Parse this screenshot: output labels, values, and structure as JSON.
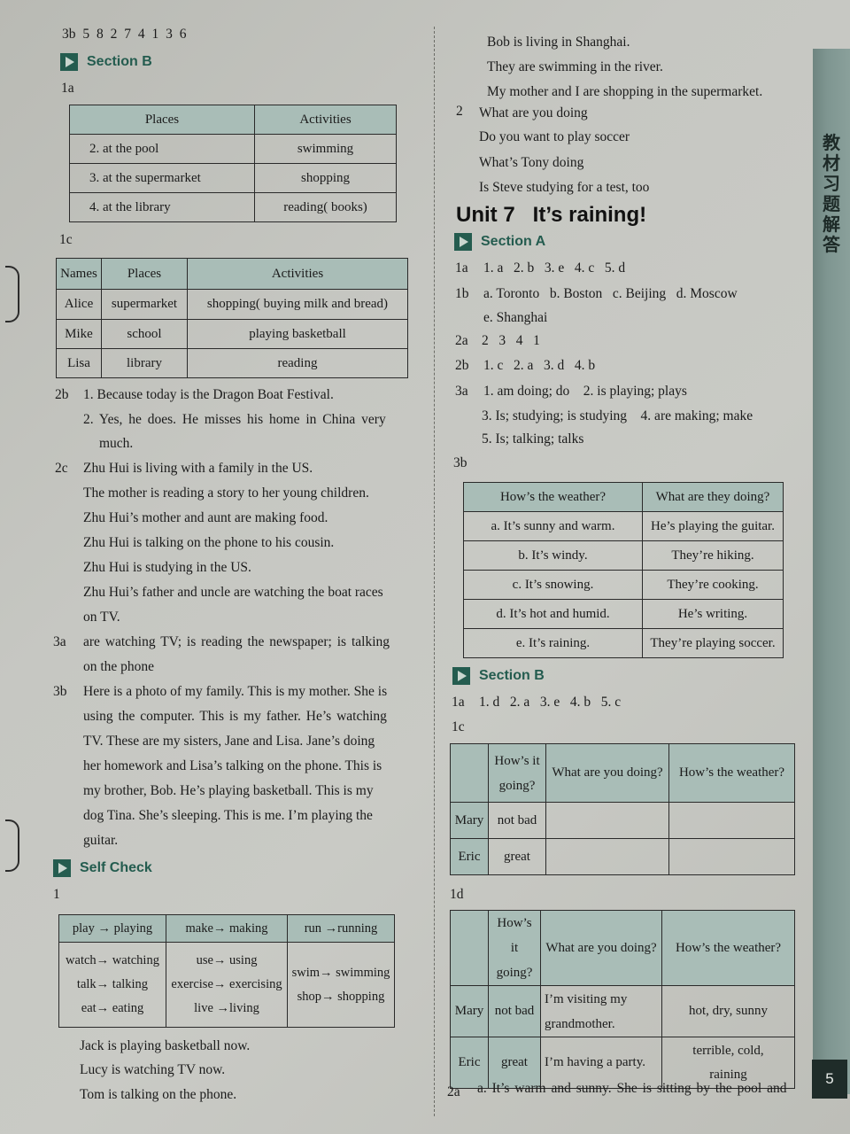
{
  "left": {
    "line_3b_top": "3b  5  8  2  7  4  1  3  6",
    "section_b": {
      "title": "Section B",
      "label_1a": "1a",
      "table_1a": {
        "headers": [
          "Places",
          "Activities"
        ],
        "rows": [
          [
            "2. at the pool",
            "swimming"
          ],
          [
            "3. at the supermarket",
            "shopping"
          ],
          [
            "4. at the library",
            "reading( books)"
          ]
        ]
      },
      "label_1c": "1c",
      "table_1c": {
        "headers": [
          "Names",
          "Places",
          "Activities"
        ],
        "rows": [
          [
            "Alice",
            "supermarket",
            "shopping( buying milk and bread)"
          ],
          [
            "Mike",
            "school",
            "playing basketball"
          ],
          [
            "Lisa",
            "library",
            "reading"
          ]
        ]
      },
      "label_2b": "2b",
      "answers_2b": [
        "1. Because today is the Dragon Boat Festival.",
        "2. Yes, he does. He misses his home in China very",
        "much."
      ],
      "label_2c": "2c",
      "answers_2c": [
        "Zhu Hui is living with a family in the US.",
        "The mother is reading a story to her young children.",
        "Zhu Hui’s mother and aunt are making food.",
        "Zhu Hui is talking on the phone to his cousin.",
        "Zhu Hui is studying in the US.",
        "Zhu Hui’s father and uncle are watching the boat races",
        "on TV."
      ],
      "label_3a": "3a",
      "answers_3a": [
        "are watching TV; is reading the newspaper; is talking",
        "on the phone"
      ],
      "label_3b": "3b",
      "answers_3b": [
        "Here is a photo of my family. This is my mother. She is",
        "using the computer. This is my father. He’s watching",
        "TV. These are my sisters, Jane and Lisa. Jane’s doing",
        "her homework and Lisa’s talking on the phone. This is",
        "my brother, Bob. He’s playing basketball. This is my",
        "dog Tina. She’s sleeping. This is me. I’m playing the",
        "guitar."
      ]
    },
    "self_check": {
      "title": "Self Check",
      "label_1": "1",
      "table": {
        "header_row": [
          "play → playing",
          "make→ making",
          "run →running"
        ],
        "body": [
          [
            "watch→ watching",
            "talk→ talking",
            "eat→ eating"
          ],
          [
            "use→ using",
            "exercise→ exercising",
            "live →living"
          ],
          [
            "swim→ swimming",
            "shop→ shopping"
          ]
        ]
      },
      "sentences": [
        "Jack is playing basketball now.",
        "Lucy is watching TV now.",
        "Tom is talking on the phone."
      ]
    }
  },
  "right": {
    "top_sentences": [
      "Bob is living in Shanghai.",
      "They are swimming in the river.",
      "My mother and I are shopping in the supermarket."
    ],
    "label_2": "2",
    "answers_2": [
      "What are you doing",
      "Do you want to play soccer",
      "What’s Tony doing",
      "Is Steve studying for a test, too"
    ],
    "unit": {
      "number": "Unit 7",
      "title": "It’s raining!"
    },
    "section_a": {
      "title": "Section A",
      "rows": [
        {
          "label": "1a",
          "text": "1. a   2. b   3. e   4. c   5. d"
        },
        {
          "label": "1b",
          "text": "a. Toronto   b. Boston   c. Beijing   d. Moscow"
        },
        {
          "label": "",
          "text": "e. Shanghai"
        },
        {
          "label": "2a",
          "text": "2   3   4   1"
        },
        {
          "label": "2b",
          "text": "1. c   2. a   3. d   4. b"
        },
        {
          "label": "3a",
          "text": "1. am doing; do    2. is playing; plays"
        },
        {
          "label": "",
          "text": "3. Is; studying; is studying    4. are making; make"
        },
        {
          "label": "",
          "text": "5. Is; talking; talks"
        }
      ],
      "label_3b": "3b",
      "table_3b": {
        "headers": [
          "How’s the weather?",
          "What are they doing?"
        ],
        "rows": [
          [
            "a. It’s sunny and warm.",
            "He’s playing the guitar."
          ],
          [
            "b. It’s windy.",
            "They’re hiking."
          ],
          [
            "c. It’s snowing.",
            "They’re cooking."
          ],
          [
            "d. It’s hot and humid.",
            "He’s writing."
          ],
          [
            "e. It’s raining.",
            "They’re playing soccer."
          ]
        ]
      }
    },
    "section_b": {
      "title": "Section B",
      "label_1a": "1a",
      "answers_1a": "1. d   2. a   3. e   4. b   5. c",
      "label_1c": "1c",
      "table_1c": {
        "headers": [
          "",
          "How’s it going?",
          "What are you doing?",
          "How’s the weather?"
        ],
        "rows": [
          [
            "Mary",
            "not bad",
            "",
            ""
          ],
          [
            "Eric",
            "great",
            "",
            ""
          ]
        ]
      },
      "label_1d": "1d",
      "table_1d": {
        "headers": [
          "",
          "How’s it going?",
          "What are you doing?",
          "How’s the weather?"
        ],
        "rows": [
          [
            "Mary",
            "not bad",
            "I’m visiting my grandmother.",
            "hot, dry, sunny"
          ],
          [
            "Eric",
            "great",
            "I’m having a party.",
            "terrible, cold, raining"
          ]
        ]
      },
      "label_2a": "2a",
      "answer_2a": "a. It’s warm and sunny. She is sitting by the pool and"
    }
  },
  "side_tab": {
    "text": "教材习题解答"
  },
  "page_number": "5"
}
